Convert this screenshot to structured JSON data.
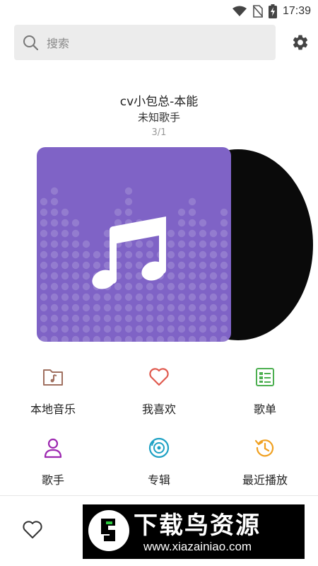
{
  "status_bar": {
    "time": "17:39",
    "icons": [
      "wifi-icon",
      "no-sim-icon",
      "battery-charging-icon"
    ]
  },
  "search": {
    "placeholder": "搜索",
    "icon": "search-icon"
  },
  "settings": {
    "icon": "gear-icon"
  },
  "now_playing": {
    "title": "cv小包总-本能",
    "artist": "未知歌手",
    "index": "3/1"
  },
  "menu": {
    "row1": [
      {
        "label": "本地音乐",
        "icon": "music-folder-icon",
        "color": "#a07060"
      },
      {
        "label": "我喜欢",
        "icon": "heart-icon",
        "color": "#e05a4f"
      },
      {
        "label": "歌单",
        "icon": "playlist-icon",
        "color": "#4caf50"
      }
    ],
    "row2": [
      {
        "label": "歌手",
        "icon": "singer-icon",
        "color": "#9c27b0"
      },
      {
        "label": "专辑",
        "icon": "album-disc-icon",
        "color": "#1da1c4"
      },
      {
        "label": "最近播放",
        "icon": "history-icon",
        "color": "#f0a020"
      }
    ]
  },
  "bottom_bar": {
    "icon": "heart-outline-icon"
  },
  "watermark": {
    "title": "下载鸟资源",
    "url": "www.xiazainiao.com"
  },
  "colors": {
    "cover": "#7f63c6",
    "search_bg": "#ececec"
  }
}
